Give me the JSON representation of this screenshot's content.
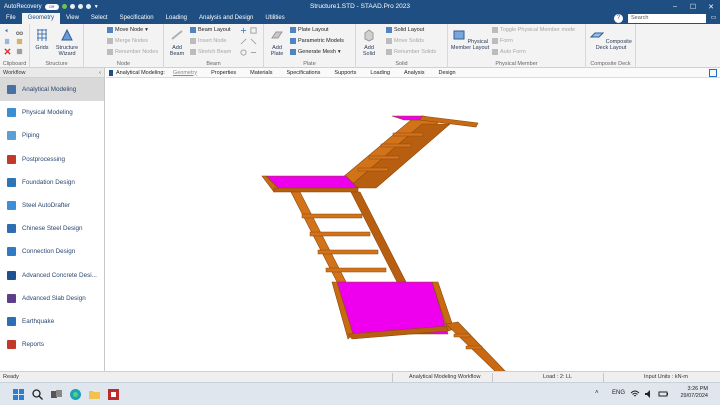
{
  "app": {
    "title": "Structure1.STD - STAAD.Pro 2023",
    "autorecovery_label": "AutoRecovery",
    "autorecovery_state": "Off"
  },
  "tabs": [
    "File",
    "Geometry",
    "View",
    "Select",
    "Specification",
    "Loading",
    "Analysis and Design",
    "Utilities"
  ],
  "active_tab": "Geometry",
  "search": {
    "placeholder": "Search"
  },
  "ribbon": {
    "clipboard": {
      "label": "Clipboard"
    },
    "structure": {
      "label": "Structure",
      "grids": "Grids",
      "wizard": "Structure Wizard"
    },
    "node": {
      "label": "Node",
      "move": "Move Node",
      "merge": "Merge Nodes",
      "renumber": "Renumber Nodes"
    },
    "beam": {
      "label": "Beam",
      "add": "Add Beam",
      "layout": "Beam Layout",
      "insert": "Insert Node",
      "stretch": "Stretch Beam"
    },
    "plate": {
      "label": "Plate",
      "add": "Add Plate",
      "layout": "Plate Layout",
      "parametric": "Parametric Models",
      "mesh": "Generate Mesh"
    },
    "solid": {
      "label": "Solid",
      "add": "Add Solid",
      "layout": "Solid Layout",
      "move": "Move Solids",
      "renumber": "Renumber Solids"
    },
    "physical_member": {
      "label": "Physical Member",
      "layout": "Physical Member Layout",
      "toggle": "Toggle Physical Member mode",
      "form": "Form",
      "auto": "Auto Form"
    },
    "composite": {
      "label": "Composite Deck",
      "layout": "Composite Deck Layout"
    }
  },
  "workflow": {
    "header": "Workflow",
    "active": "Analytical Modeling",
    "items": [
      {
        "label": "Analytical Modeling",
        "icon": "analytical-modeling-icon",
        "color": "#4a6fa5"
      },
      {
        "label": "Physical Modeling",
        "icon": "physical-modeling-icon",
        "color": "#3a8fd0"
      },
      {
        "label": "Piping",
        "icon": "piping-icon",
        "color": "#5aa0d8"
      },
      {
        "label": "Postprocessing",
        "icon": "postprocessing-icon",
        "color": "#c0392b"
      },
      {
        "label": "Foundation Design",
        "icon": "foundation-design-icon",
        "color": "#2e75b6"
      },
      {
        "label": "Steel AutoDrafter",
        "icon": "steel-autodrafter-icon",
        "color": "#3b8ed8"
      },
      {
        "label": "Chinese Steel Design",
        "icon": "chinese-steel-design-icon",
        "color": "#2f6db0"
      },
      {
        "label": "Connection Design",
        "icon": "connection-design-icon",
        "color": "#2e7bc4"
      },
      {
        "label": "Advanced Concrete Desi...",
        "icon": "advanced-concrete-design-icon",
        "color": "#1d4f91"
      },
      {
        "label": "Advanced Slab Design",
        "icon": "advanced-slab-design-icon",
        "color": "#5b3f8c"
      },
      {
        "label": "Earthquake",
        "icon": "earthquake-icon",
        "color": "#2c6fb2"
      },
      {
        "label": "Reports",
        "icon": "reports-icon",
        "color": "#c0392b"
      }
    ]
  },
  "subtabs": {
    "prefix": "Analytical Modeling:",
    "items": [
      "Geometry",
      "Properties",
      "Materials",
      "Specifications",
      "Supports",
      "Loading",
      "Analysis",
      "Design"
    ],
    "active": "Geometry"
  },
  "model": {
    "beam_color": "#c96a12",
    "plate_color": "#ee00ee"
  },
  "status": {
    "left": "Ready",
    "workflow": "Analytical Modeling Workflow",
    "load": "Load : 2: LL",
    "units": "Input Units : kN-m"
  },
  "taskbar": {
    "lang": "ENG",
    "time": "3:26 PM",
    "date": "29/07/2024"
  }
}
